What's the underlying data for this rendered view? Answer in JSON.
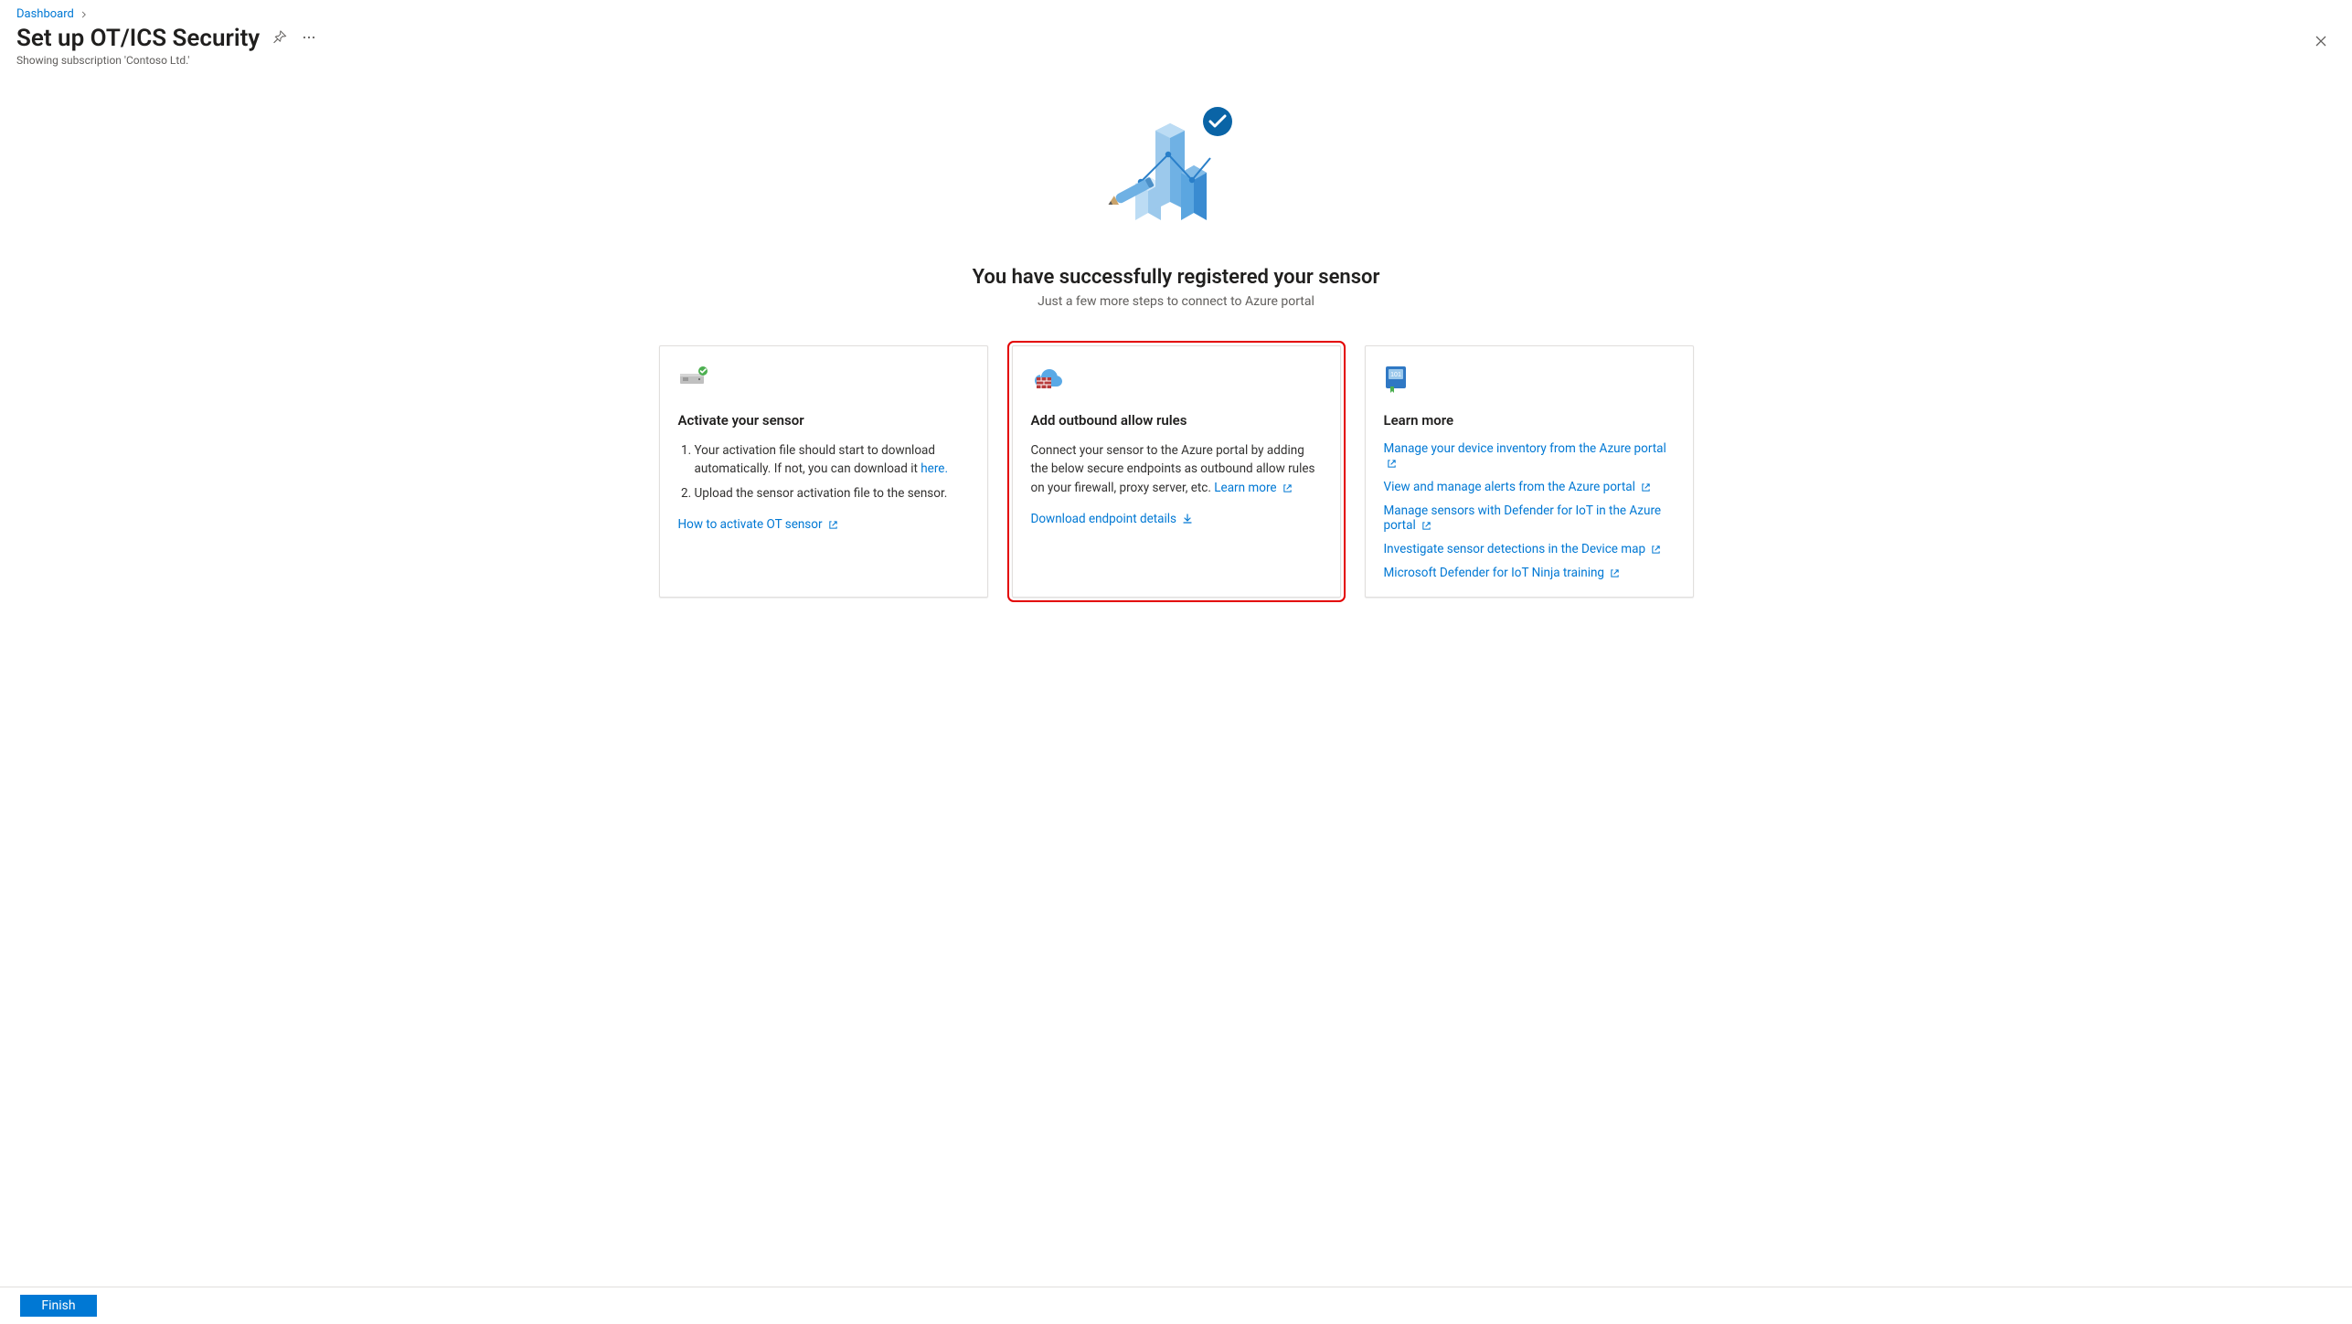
{
  "breadcrumb": {
    "dashboard": "Dashboard"
  },
  "header": {
    "title": "Set up OT/ICS Security",
    "subtitle": "Showing subscription 'Contoso Ltd.'"
  },
  "hero": {
    "title": "You have successfully registered your sensor",
    "subtitle": "Just a few more steps to connect to Azure portal"
  },
  "cards": {
    "activate": {
      "title": "Activate your sensor",
      "step1a": "Your activation file should start to download automatically. If not, you can download it ",
      "step1_link": "here.",
      "step2": "Upload the sensor activation file to the sensor.",
      "howto": "How to activate OT sensor"
    },
    "outbound": {
      "title": "Add outbound allow rules",
      "desc": "Connect your sensor to the Azure portal by adding the below secure endpoints as outbound allow rules on your firewall, proxy server, etc. ",
      "learn_more": "Learn more",
      "download": "Download endpoint details"
    },
    "learn": {
      "title": "Learn more",
      "links": [
        "Manage your device inventory from the Azure portal",
        "View and manage alerts from the Azure portal",
        "Manage sensors with Defender for IoT in the Azure portal",
        "Investigate sensor detections in the Device map",
        "Microsoft Defender for IoT Ninja training"
      ]
    }
  },
  "footer": {
    "finish": "Finish"
  }
}
